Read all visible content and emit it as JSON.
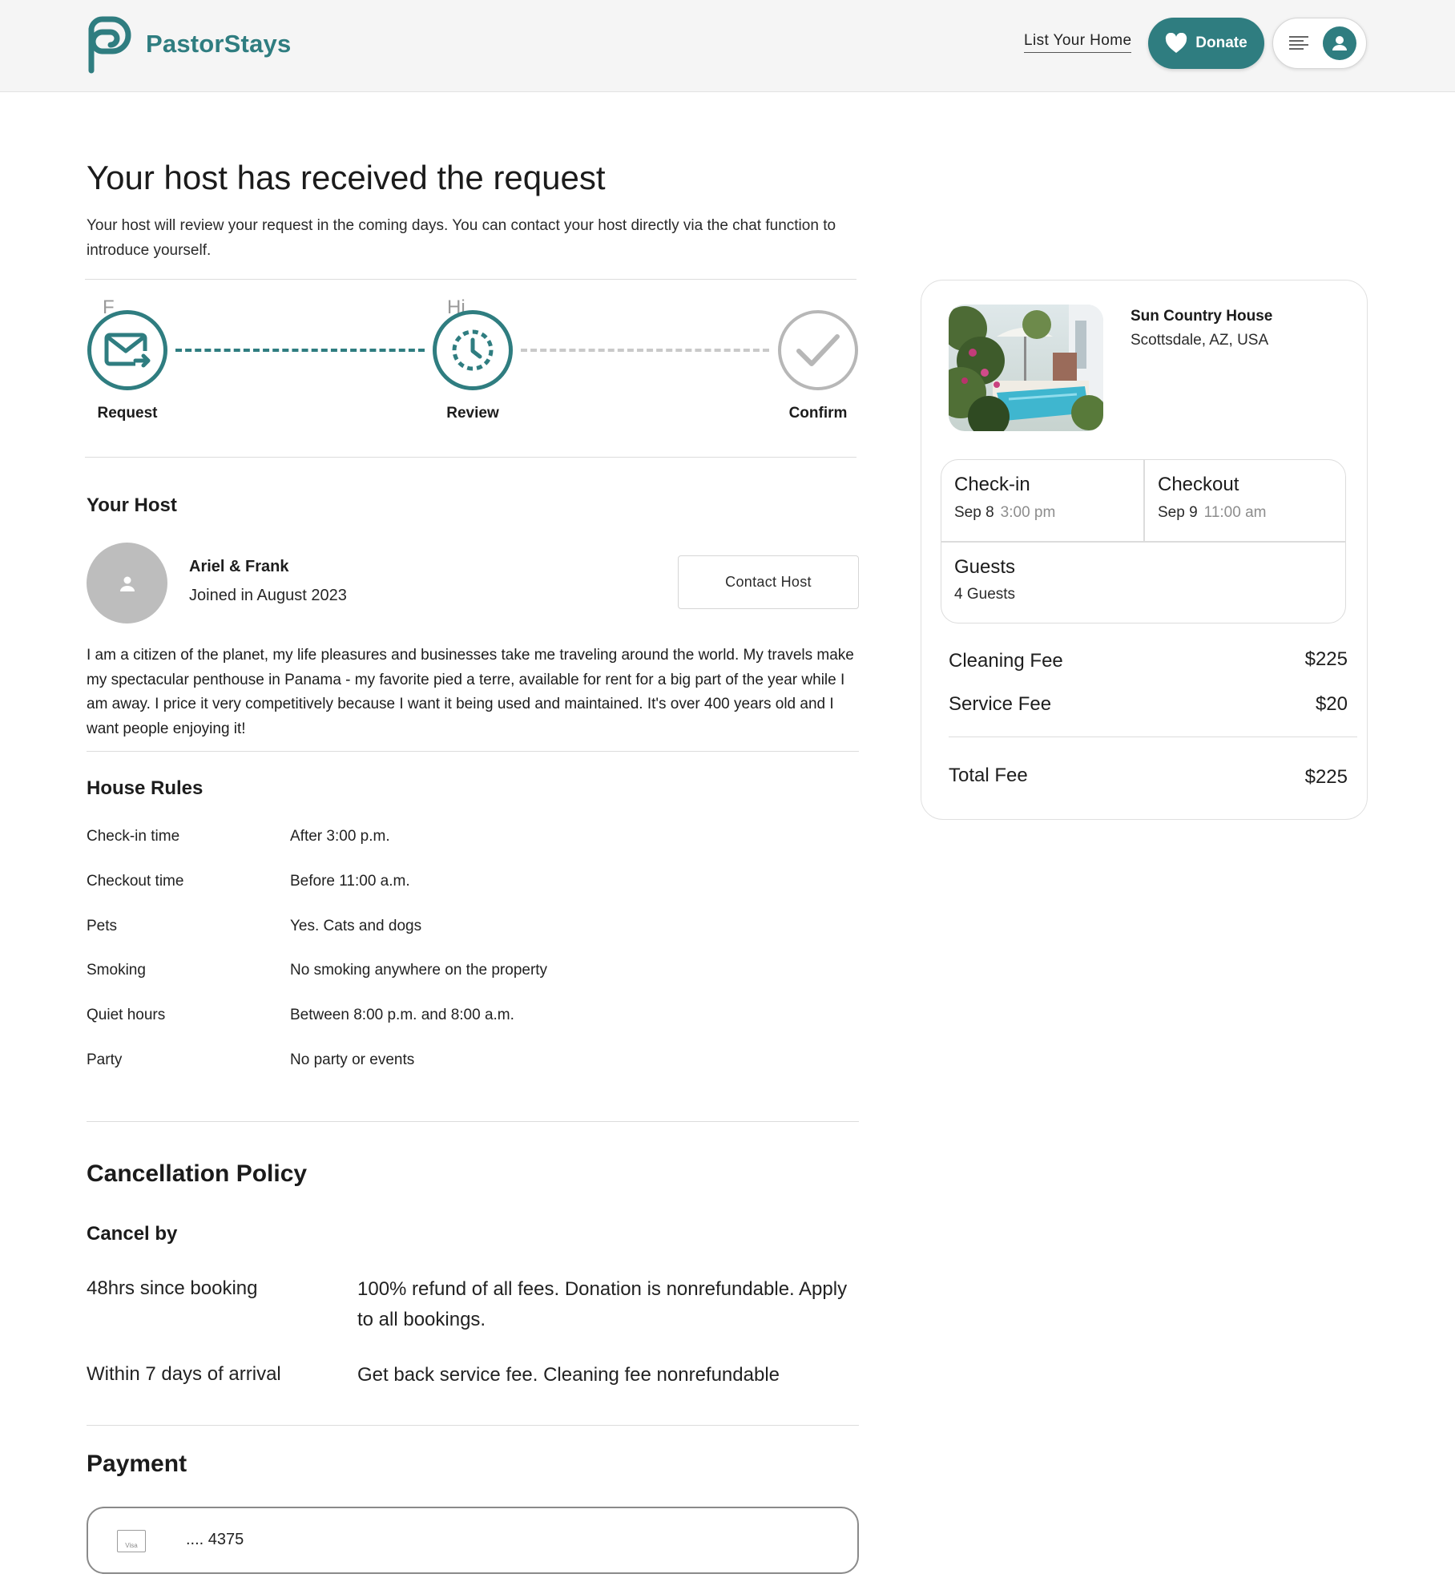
{
  "header": {
    "brand": "PastorStays",
    "list_home": "List Your Home",
    "donate": "Donate",
    "icons": {
      "logo": "pastorstays-logo",
      "donate": "heart-icon",
      "menu": "menu-lines-icon",
      "user": "user-avatar-icon"
    },
    "accent_color": "#2f7d80"
  },
  "intro": {
    "title": "Your host has received the request",
    "subtitle": "Your host will review your request in the coming days. You can contact your host directly via the chat function to introduce yourself."
  },
  "progress": {
    "ghost_left": "F",
    "ghost_mid": "Hi",
    "steps": [
      {
        "label": "Request",
        "icon": "envelope-arrow-icon",
        "state": "done"
      },
      {
        "label": "Review",
        "icon": "clock-icon",
        "state": "current"
      },
      {
        "label": "Confirm",
        "icon": "check-icon",
        "state": "pending"
      }
    ]
  },
  "host": {
    "section_title": "Your Host",
    "name": "Ariel & Frank",
    "joined": "Joined in August 2023",
    "contact_button": "Contact Host",
    "bio": "I am a citizen of the planet, my life pleasures and businesses take me traveling around the world. My travels make my spectacular penthouse in Panama - my favorite pied a terre, available for rent for a big part of the year while I am away. I price it very competitively because I want it being used and maintained. It's over 400 years old and I want people enjoying it!"
  },
  "house_rules": {
    "title": "House Rules",
    "rows": [
      {
        "label": "Check-in time",
        "value": "After 3:00 p.m."
      },
      {
        "label": "Checkout time",
        "value": "Before 11:00 a.m."
      },
      {
        "label": "Pets",
        "value": "Yes. Cats and dogs"
      },
      {
        "label": "Smoking",
        "value": "No smoking anywhere on the property"
      },
      {
        "label": "Quiet hours",
        "value": "Between 8:00 p.m. and 8:00 a.m."
      },
      {
        "label": "Party",
        "value": "No party or events"
      }
    ]
  },
  "cancellation": {
    "title": "Cancellation Policy",
    "subtitle": "Cancel by",
    "rows": [
      {
        "label": "48hrs since booking",
        "value": "100% refund of all fees. Donation is nonrefundable. Apply to all bookings."
      },
      {
        "label": "Within 7 days of arrival",
        "value": "Get back service fee. Cleaning fee nonrefundable"
      }
    ]
  },
  "payment": {
    "title": "Payment",
    "card_brand": "Visa",
    "card_number": ".... 4375"
  },
  "summary": {
    "property_name": "Sun Country House",
    "property_location": "Scottsdale, AZ, USA",
    "checkin_label": "Check-in",
    "checkin_date": "Sep 8",
    "checkin_time": "3:00 pm",
    "checkout_label": "Checkout",
    "checkout_date": "Sep 9",
    "checkout_time": "11:00 am",
    "guests_label": "Guests",
    "guests_value": "4 Guests",
    "fees": [
      {
        "label": "Cleaning Fee",
        "value": "$225"
      },
      {
        "label": "Service Fee",
        "value": "$20"
      }
    ],
    "total_label": "Total Fee",
    "total_value": "$225"
  }
}
